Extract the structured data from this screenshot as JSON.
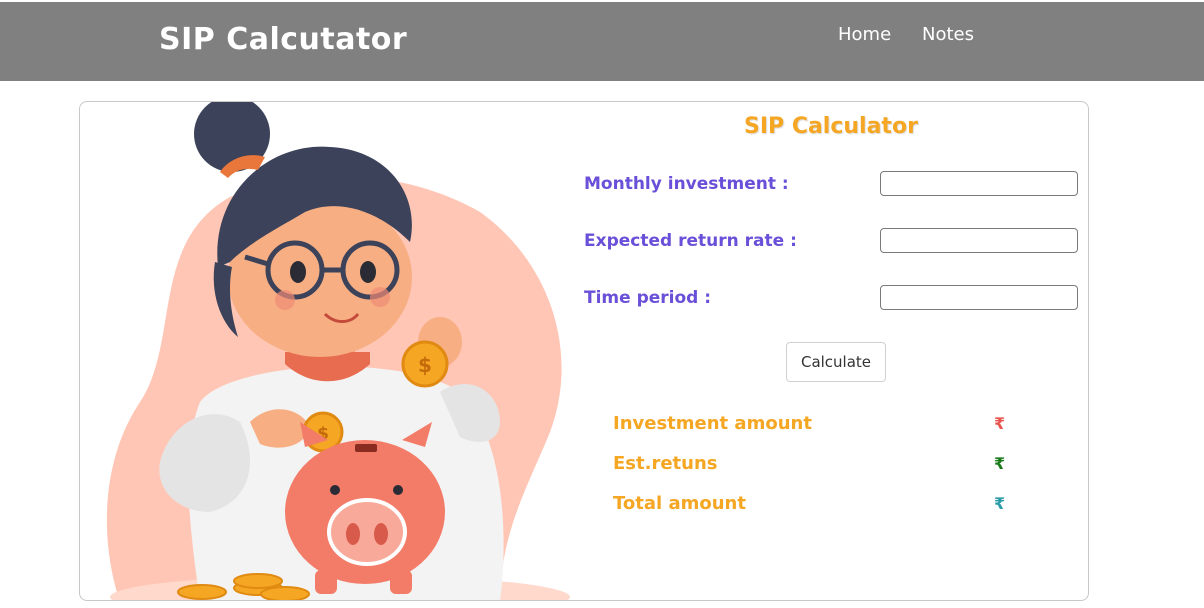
{
  "navbar": {
    "brand": "SIP Calcutator",
    "links": [
      "Home",
      "Notes"
    ]
  },
  "form": {
    "title": "SIP Calculator",
    "fields": [
      {
        "label": "Monthly investment :",
        "value": "",
        "placeholder": ""
      },
      {
        "label": "Expected return rate :",
        "value": "",
        "placeholder": ""
      },
      {
        "label": "Time period :",
        "value": "",
        "placeholder": ""
      }
    ],
    "button_label": "Calculate"
  },
  "results": [
    {
      "label": "Investment amount",
      "value": "₹",
      "color": "#e8554e"
    },
    {
      "label": "Est.retuns",
      "value": "₹",
      "color": "#1a7a1a"
    },
    {
      "label": "Total amount",
      "value": "₹",
      "color": "#2a9ba8"
    }
  ],
  "colors": {
    "navbar_bg": "#808080",
    "title_accent": "#f5a623",
    "label_purple": "#6a4fd8"
  },
  "icons": {
    "illustration": "woman-saving-coins-piggy-bank-illustration"
  }
}
